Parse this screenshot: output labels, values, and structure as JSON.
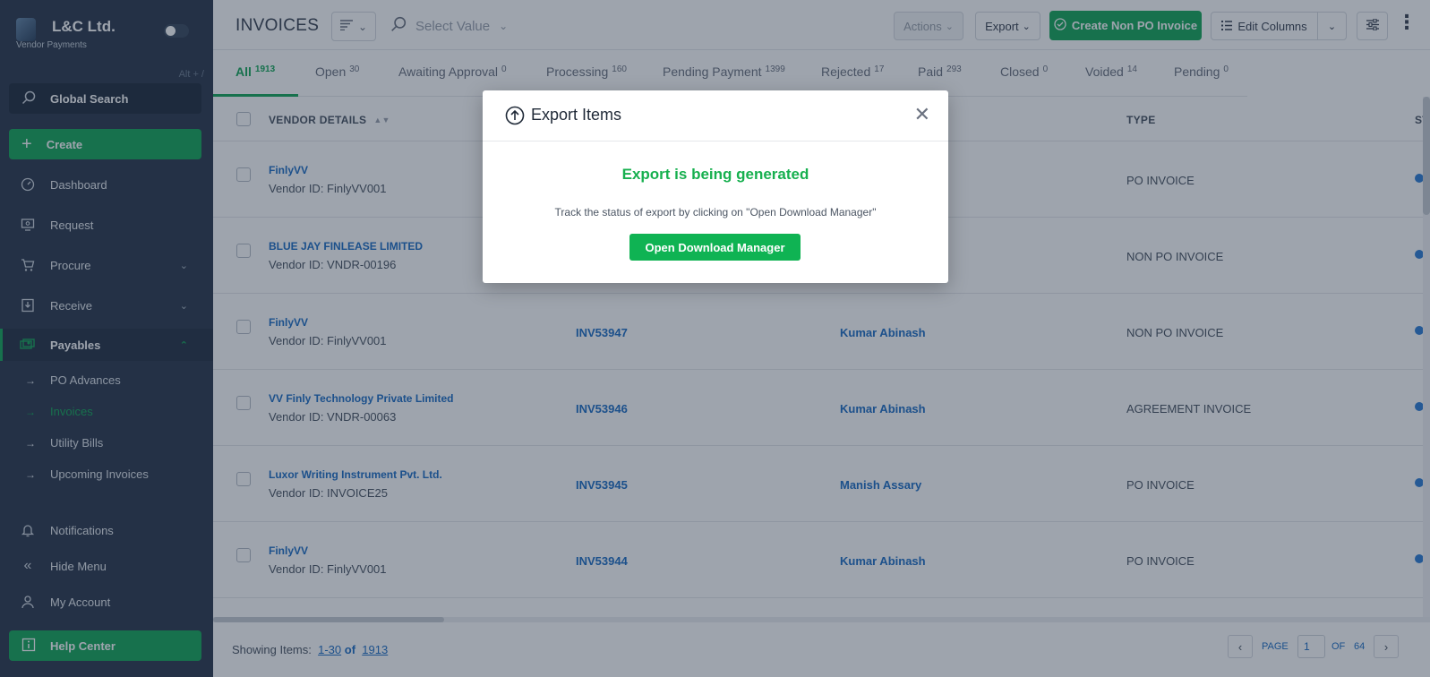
{
  "sidebar": {
    "brand_name": "L&C Ltd.",
    "brand_sub": "Vendor Payments",
    "shortcut": "Alt + /",
    "global_search": "Global Search",
    "create": "Create",
    "items": {
      "dashboard": "Dashboard",
      "request": "Request",
      "procure": "Procure",
      "receive": "Receive",
      "payables": "Payables"
    },
    "sub_items": {
      "po_advances": "PO Advances",
      "invoices": "Invoices",
      "utility_bills": "Utility Bills",
      "upcoming_invoices": "Upcoming Invoices"
    },
    "bottom": {
      "notifications": "Notifications",
      "hide_menu": "Hide Menu",
      "my_account": "My Account",
      "help_center": "Help Center"
    }
  },
  "header": {
    "title": "INVOICES",
    "select_placeholder": "Select Value",
    "actions": "Actions",
    "export": "Export",
    "create_non_po": "Create Non PO Invoice",
    "edit_columns": "Edit Columns"
  },
  "tabs": [
    {
      "label": "All",
      "count": "1913"
    },
    {
      "label": "Open",
      "count": "30"
    },
    {
      "label": "Awaiting Approval",
      "count": "0"
    },
    {
      "label": "Processing",
      "count": "160"
    },
    {
      "label": "Pending Payment",
      "count": "1399"
    },
    {
      "label": "Rejected",
      "count": "17"
    },
    {
      "label": "Paid",
      "count": "293"
    },
    {
      "label": "Closed",
      "count": "0"
    },
    {
      "label": "Voided",
      "count": "14"
    },
    {
      "label": "Pending",
      "count": "0"
    }
  ],
  "table": {
    "columns": {
      "vendor": "VENDOR DETAILS",
      "type": "TYPE",
      "status": "ST"
    },
    "rows": [
      {
        "vendor": "FinlyVV",
        "vendor_id": "Vendor ID: FinlyVV001",
        "invoice": "",
        "person": "",
        "type": "PO INVOICE"
      },
      {
        "vendor": "BLUE JAY FINLEASE LIMITED",
        "vendor_id": "Vendor ID: VNDR-00196",
        "invoice": "",
        "person": "",
        "type": "NON PO INVOICE"
      },
      {
        "vendor": "FinlyVV",
        "vendor_id": "Vendor ID: FinlyVV001",
        "invoice": "INV53947",
        "person": "Kumar Abinash",
        "type": "NON PO INVOICE"
      },
      {
        "vendor": "VV Finly Technology Private Limited",
        "vendor_id": "Vendor ID: VNDR-00063",
        "invoice": "INV53946",
        "person": "Kumar Abinash",
        "type": "AGREEMENT INVOICE"
      },
      {
        "vendor": "Luxor Writing Instrument Pvt. Ltd.",
        "vendor_id": "Vendor ID: INVOICE25",
        "invoice": "INV53945",
        "person": "Manish Assary",
        "type": "PO INVOICE"
      },
      {
        "vendor": "FinlyVV",
        "vendor_id": "Vendor ID: FinlyVV001",
        "invoice": "INV53944",
        "person": "Kumar Abinash",
        "type": "PO INVOICE"
      }
    ]
  },
  "footer": {
    "showing_label": "Showing Items:",
    "range": "1-30",
    "of": "of",
    "total": "1913",
    "page_label": "PAGE",
    "page_value": "1",
    "of_label": "OF",
    "page_total": "64"
  },
  "modal": {
    "title": "Export Items",
    "message": "Export is being generated",
    "sub": "Track the status of export by clicking on \"Open Download Manager\"",
    "button": "Open Download Manager"
  },
  "colors": {
    "accent": "#17a75a",
    "sidebar": "#2d3a4e",
    "link": "#1f6fc5"
  }
}
